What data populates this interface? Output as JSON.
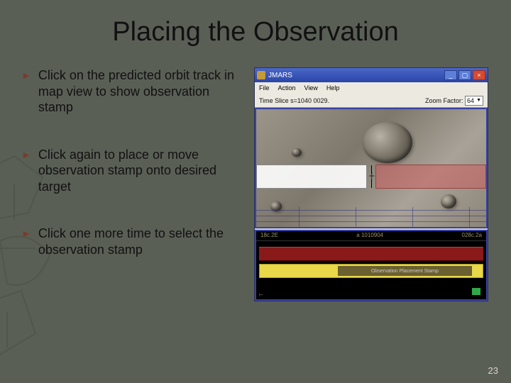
{
  "title": "Placing the Observation",
  "bullets": [
    "Click on the predicted orbit track in map view to show observation stamp",
    "Click again to place or move observation stamp onto desired target",
    "Click one more time to select the observation stamp"
  ],
  "app": {
    "title": "JMARS",
    "menus": [
      "File",
      "Action",
      "View",
      "Help"
    ],
    "status_left": "Time Slice  s=1040  0029.",
    "zoom_label": "Zoom Factor:",
    "zoom_value": "64",
    "ruler": [
      "18c.2E",
      "a 1010904",
      "028c.2a"
    ],
    "footer_label": "Observation Placement Stamp",
    "track_labels": {
      "red": "",
      "yellow": ""
    }
  },
  "page_number": "23"
}
